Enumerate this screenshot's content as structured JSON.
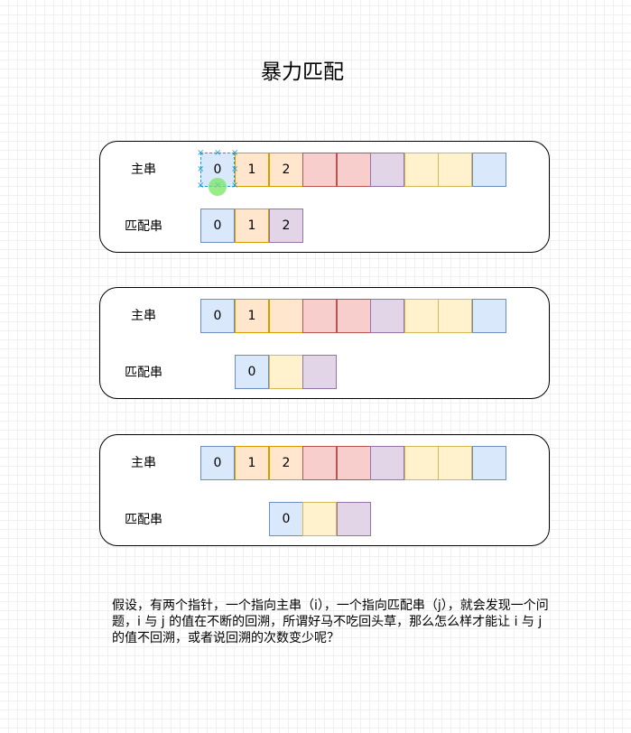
{
  "title": "暴力匹配",
  "labels": {
    "main": "主串",
    "pattern": "匹配串"
  },
  "panels": [
    {
      "main": [
        {
          "text": "0",
          "color": "#dae8fc"
        },
        {
          "text": "1",
          "color": "#ffe6cc"
        },
        {
          "text": "2",
          "color": "#ffe6cc"
        },
        {
          "text": "",
          "color": "#f8cecc"
        },
        {
          "text": "",
          "color": "#f8cecc"
        },
        {
          "text": "",
          "color": "#e1d5e7"
        },
        {
          "text": "",
          "color": "#fff2cc"
        },
        {
          "text": "",
          "color": "#fff2cc"
        },
        {
          "text": "",
          "color": "#dae8fc"
        }
      ],
      "pattern": [
        {
          "text": "0",
          "color": "#dae8fc"
        },
        {
          "text": "1",
          "color": "#ffe6cc"
        },
        {
          "text": "2",
          "color": "#e1d5e7"
        }
      ]
    },
    {
      "main": [
        {
          "text": "0",
          "color": "#dae8fc"
        },
        {
          "text": "1",
          "color": "#ffe6cc"
        },
        {
          "text": "",
          "color": "#ffe6cc"
        },
        {
          "text": "",
          "color": "#f8cecc"
        },
        {
          "text": "",
          "color": "#f8cecc"
        },
        {
          "text": "",
          "color": "#e1d5e7"
        },
        {
          "text": "",
          "color": "#fff2cc"
        },
        {
          "text": "",
          "color": "#fff2cc"
        },
        {
          "text": "",
          "color": "#dae8fc"
        }
      ],
      "pattern": [
        {
          "text": "0",
          "color": "#dae8fc"
        },
        {
          "text": "",
          "color": "#fff2cc"
        },
        {
          "text": "",
          "color": "#e1d5e7"
        }
      ]
    },
    {
      "main": [
        {
          "text": "0",
          "color": "#dae8fc"
        },
        {
          "text": "1",
          "color": "#ffe6cc"
        },
        {
          "text": "2",
          "color": "#ffe6cc"
        },
        {
          "text": "",
          "color": "#f8cecc"
        },
        {
          "text": "",
          "color": "#f8cecc"
        },
        {
          "text": "",
          "color": "#e1d5e7"
        },
        {
          "text": "",
          "color": "#fff2cc"
        },
        {
          "text": "",
          "color": "#fff2cc"
        },
        {
          "text": "",
          "color": "#dae8fc"
        }
      ],
      "pattern": [
        {
          "text": "0",
          "color": "#dae8fc"
        },
        {
          "text": "",
          "color": "#fff2cc"
        },
        {
          "text": "",
          "color": "#e1d5e7"
        }
      ]
    }
  ],
  "description": "假设，有两个指针，一个指向主串（i），一个指向匹配串（j），就会发现一个问题，i 与 j 的值在不断的回溯，所谓好马不吃回头草，那么怎么样才能让 i 与 j 的值不回溯，或者说回溯的次数变少呢？"
}
